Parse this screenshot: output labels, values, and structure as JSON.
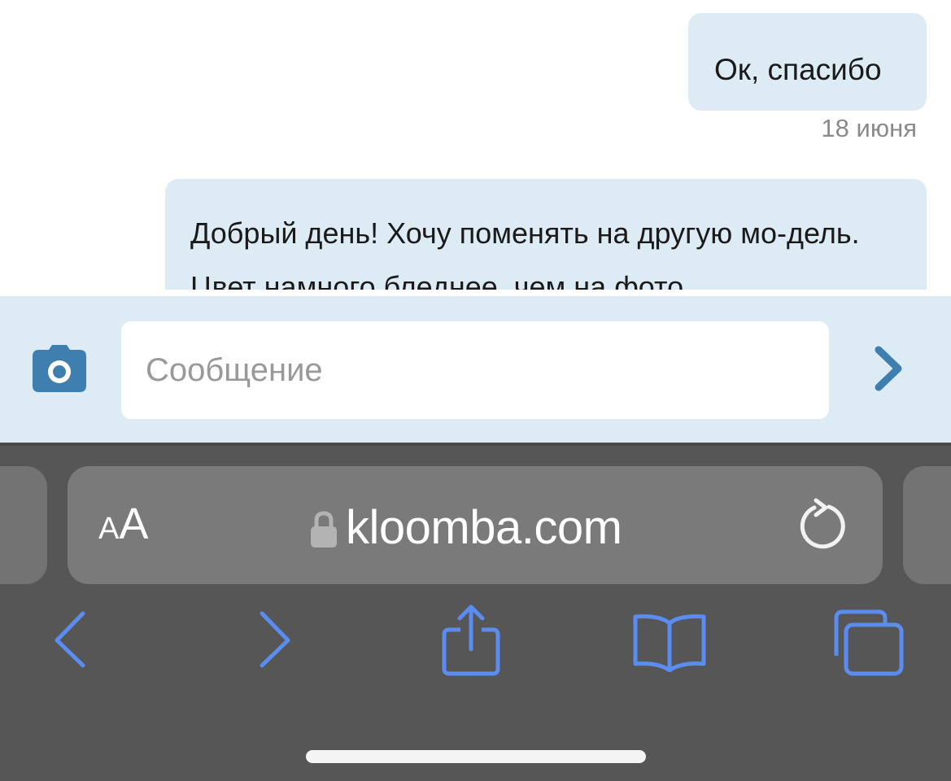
{
  "chat": {
    "messages": [
      {
        "text": "Ок, спасибо",
        "timestamp": "18 июня"
      },
      {
        "text": "Добрый день! Хочу поменять на другую мо-дель. Цвет намного бледнее, чем на фото."
      }
    ]
  },
  "composer": {
    "placeholder": "Сообщение",
    "value": ""
  },
  "browser": {
    "text_size_button_small": "A",
    "text_size_button_large": "A",
    "url": "kloomba.com"
  },
  "colors": {
    "bubble": "#dcebf4",
    "accent": "#3f7fb0",
    "safari_blue": "#5b8cf0",
    "toolbar_bg": "#565656"
  },
  "icons": {
    "camera": "camera-icon",
    "send": "chevron-right-icon",
    "lock": "lock-icon",
    "reload": "reload-icon",
    "back": "back-arrow-icon",
    "forward": "forward-arrow-icon",
    "share": "share-icon",
    "bookmarks": "bookmarks-icon",
    "tabs": "tabs-icon"
  }
}
